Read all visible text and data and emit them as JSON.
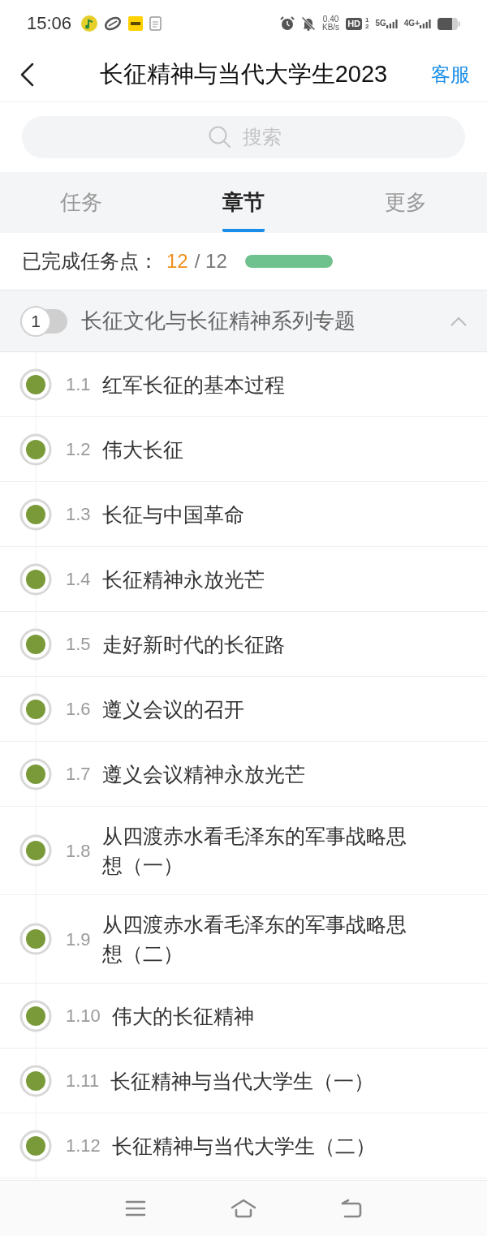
{
  "status_bar": {
    "time": "15:06",
    "net_speed": "0.40",
    "net_speed_unit": "KB/s",
    "hd_label": "HD",
    "hd_sims": [
      "1",
      "2"
    ],
    "networks": [
      "5G",
      "4G+"
    ]
  },
  "header": {
    "title": "长征精神与当代大学生2023",
    "action": "客服"
  },
  "search": {
    "placeholder": "搜索"
  },
  "tabs": [
    {
      "label": "任务",
      "selected": false
    },
    {
      "label": "章节",
      "selected": true
    },
    {
      "label": "更多",
      "selected": false
    }
  ],
  "progress": {
    "label": "已完成任务点：",
    "done": "12",
    "total": "/ 12",
    "level": 1
  },
  "chapter": {
    "number": "1",
    "title": "长征文化与长征精神系列专题",
    "expanded": true,
    "sections": [
      {
        "number": "1.1",
        "title": "红军长征的基本过程",
        "completed": true
      },
      {
        "number": "1.2",
        "title": "伟大长征",
        "completed": true
      },
      {
        "number": "1.3",
        "title": "长征与中国革命",
        "completed": true
      },
      {
        "number": "1.4",
        "title": "长征精神永放光芒",
        "completed": true
      },
      {
        "number": "1.5",
        "title": "走好新时代的长征路",
        "completed": true
      },
      {
        "number": "1.6",
        "title": "遵义会议的召开",
        "completed": true
      },
      {
        "number": "1.7",
        "title": "遵义会议精神永放光芒",
        "completed": true
      },
      {
        "number": "1.8",
        "title": "从四渡赤水看毛泽东的军事战略思想（一）",
        "completed": true
      },
      {
        "number": "1.9",
        "title": "从四渡赤水看毛泽东的军事战略思想（二）",
        "completed": true
      },
      {
        "number": "1.10",
        "title": "伟大的长征精神",
        "completed": true
      },
      {
        "number": "1.11",
        "title": "长征精神与当代大学生（一）",
        "completed": true
      },
      {
        "number": "1.12",
        "title": "长征精神与当代大学生（二）",
        "completed": true
      }
    ]
  }
}
